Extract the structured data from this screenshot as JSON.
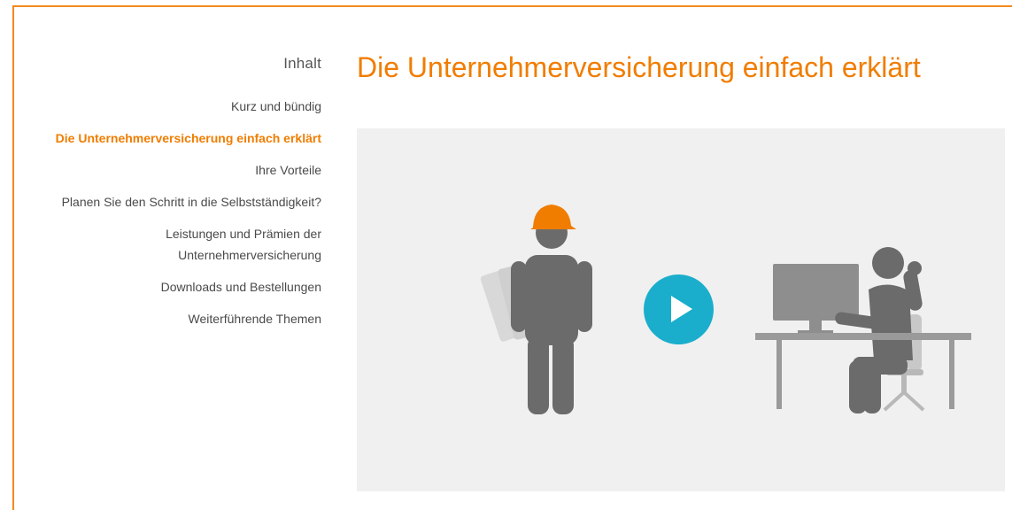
{
  "toc": {
    "title": "Inhalt",
    "items": [
      {
        "label": "Kurz und bündig"
      },
      {
        "label": "Die Unternehmerversicherung einfach erklärt"
      },
      {
        "label": "Ihre Vorteile"
      },
      {
        "label": "Planen Sie den Schritt in die Selbstständigkeit?"
      },
      {
        "label": "Leistungen und Prämien der Unternehmerversicherung"
      },
      {
        "label": "Downloads und Bestellungen"
      },
      {
        "label": "Weiterführende Themen"
      }
    ],
    "active_index": 1
  },
  "main": {
    "title": "Die Unternehmerversicherung einfach erklärt"
  },
  "video": {
    "play_icon": "play-icon",
    "illustrations": [
      "construction-worker-icon",
      "office-worker-desk-icon"
    ]
  },
  "colors": {
    "accent": "#f07d00",
    "frame": "#f28a1e",
    "play": "#1aaecc",
    "figure": "#6b6b6b",
    "video_bg": "#f0f0f0"
  }
}
